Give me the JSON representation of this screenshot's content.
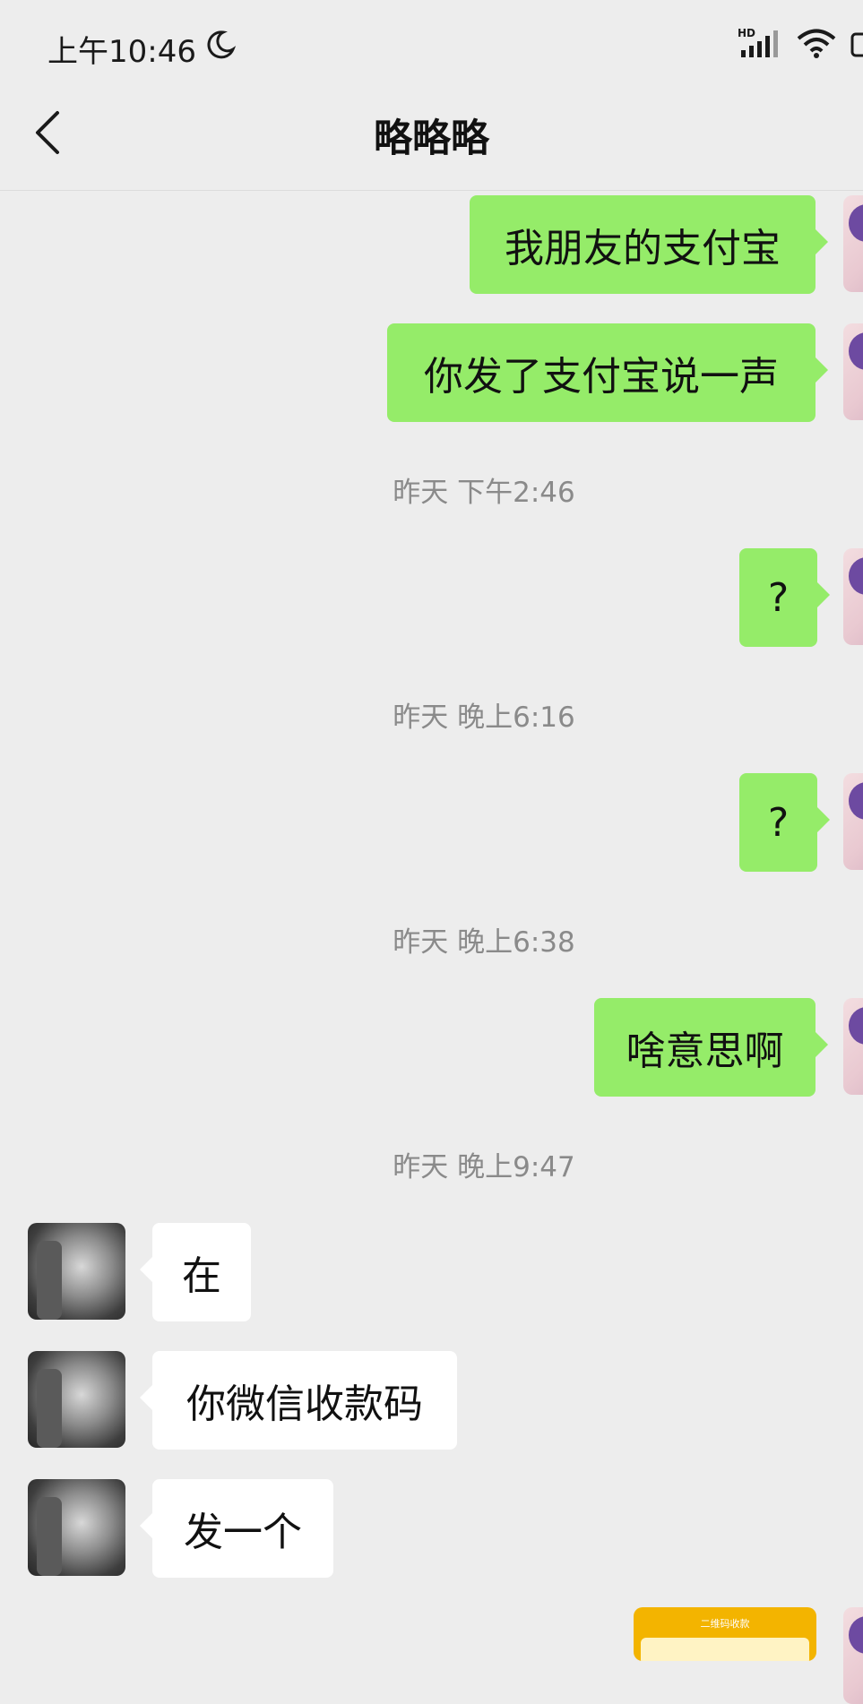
{
  "status_bar": {
    "time": "上午10:46",
    "network": "HD"
  },
  "header": {
    "title": "略略略"
  },
  "messages": [
    {
      "text": "我朋友的支付宝"
    },
    {
      "text": "你发了支付宝说一声"
    },
    {
      "text": "?"
    },
    {
      "text": "?"
    },
    {
      "text": "啥意思啊"
    },
    {
      "text": "在"
    },
    {
      "text": "你微信收款码"
    },
    {
      "text": "发一个"
    }
  ],
  "timestamps": [
    "昨天 下午2:46",
    "昨天 晚上6:16",
    "昨天 晚上6:38",
    "昨天 晚上9:47"
  ],
  "image_message": {
    "label": "二维码收款"
  },
  "colors": {
    "outgoing_bubble": "#95ec69",
    "incoming_bubble": "#ffffff",
    "background": "#ededed"
  }
}
